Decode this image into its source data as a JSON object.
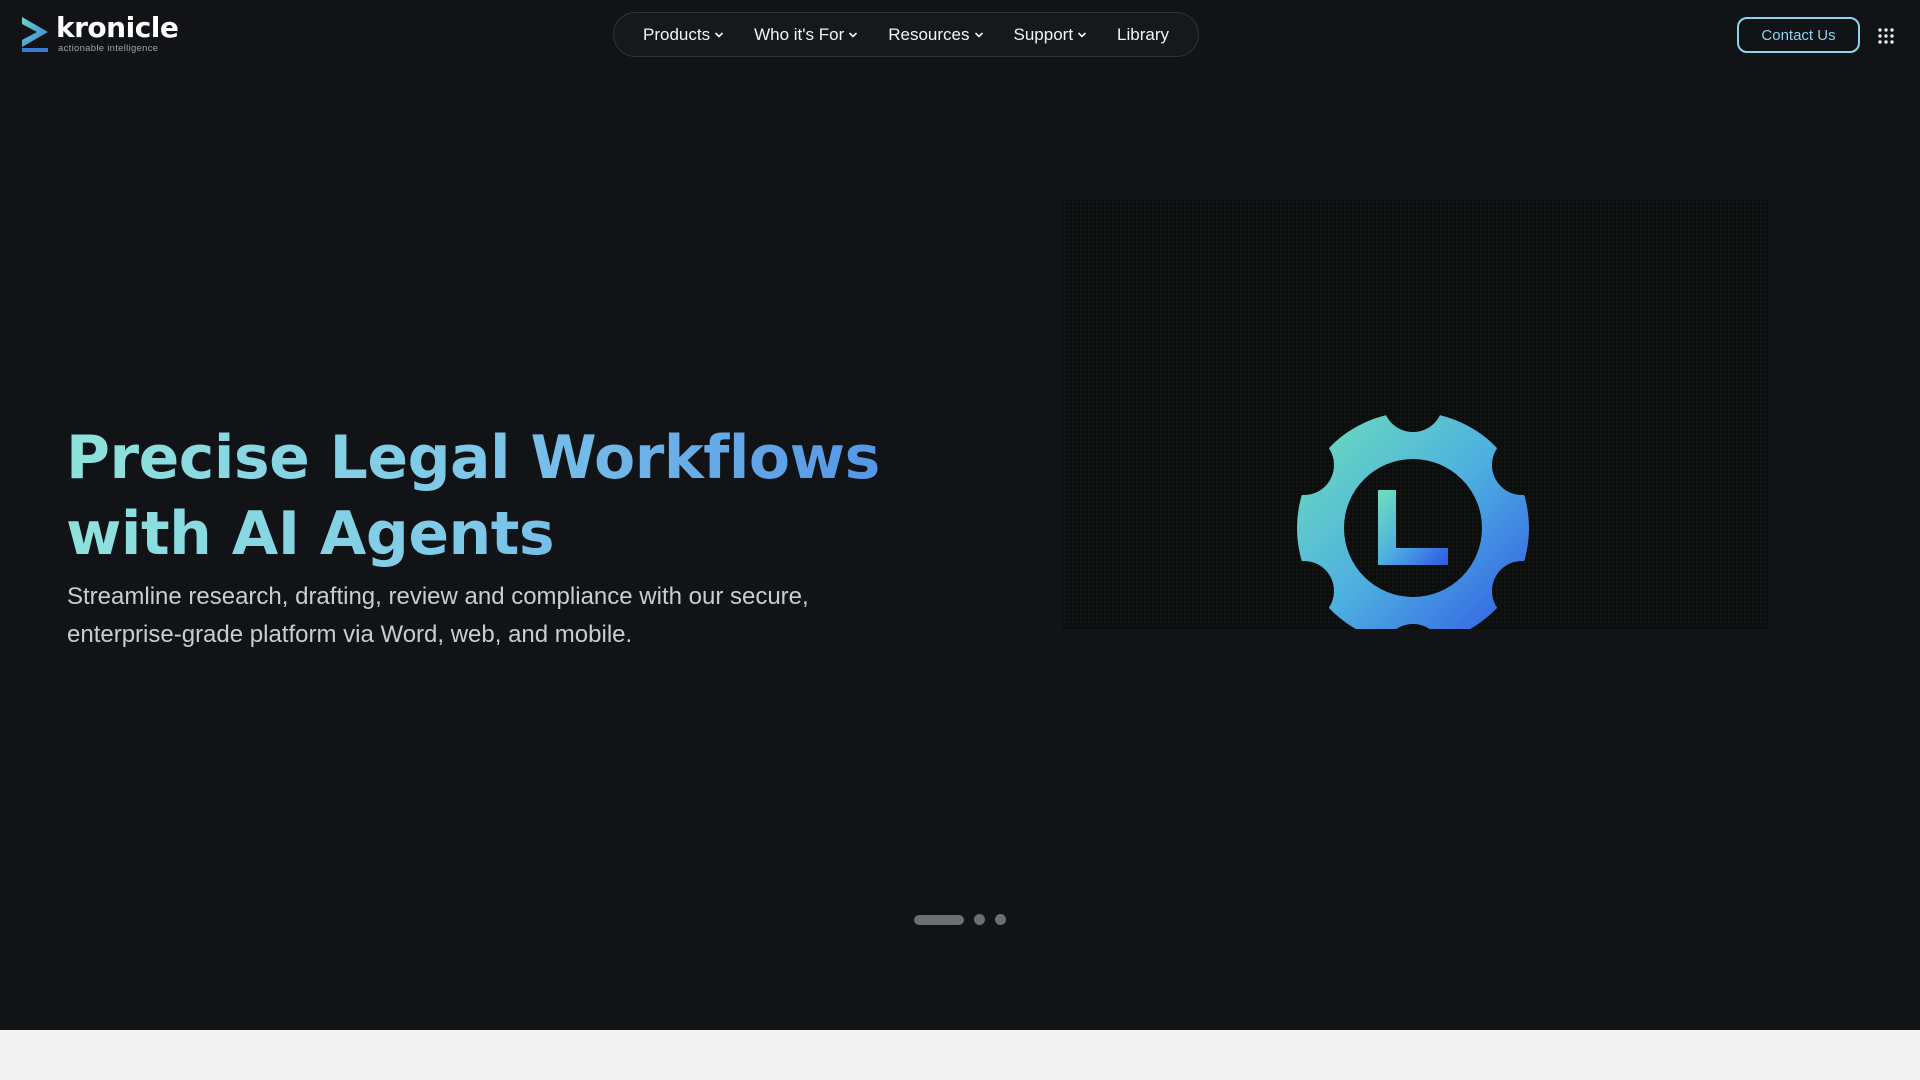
{
  "brand": {
    "name": "kronicle",
    "tagline": "actionable intelligence"
  },
  "nav": {
    "items": [
      {
        "label": "Products",
        "icon": "chevron-down-icon"
      },
      {
        "label": "Who it's For",
        "icon": "chevron-down-icon"
      },
      {
        "label": "Resources",
        "icon": "chevron-down-icon"
      },
      {
        "label": "Support",
        "icon": "chevron-down-icon"
      },
      {
        "label": "Library"
      }
    ]
  },
  "header": {
    "contact_label": "Contact Us",
    "apps_icon": "grid-menu-icon"
  },
  "hero": {
    "headline_line1": "Precise Legal Workflows",
    "headline_line2": "with AI Agents",
    "subtitle_line1": "Streamline research, drafting, review and compliance with our secure,",
    "subtitle_line2": "enterprise-grade platform via Word, web, and mobile.",
    "visual_icon": "gear-l-logo-icon",
    "visual_letter": "L"
  },
  "carousel": {
    "slide_count": 3,
    "active_index": 0
  },
  "colors": {
    "background": "#111316",
    "accent": "#8fd3ee",
    "headline_gradient_start": "#8fe3dc",
    "headline_gradient_end": "#4c8be6",
    "lower_section": "#f2f2f2"
  }
}
